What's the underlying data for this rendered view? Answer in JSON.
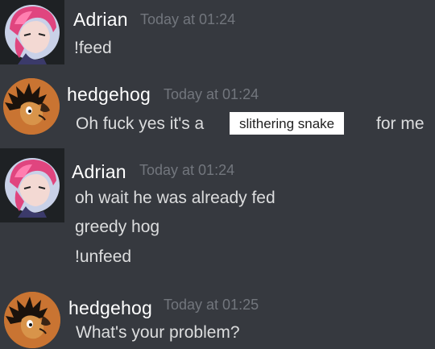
{
  "messages": [
    {
      "author": "Adrian",
      "avatar_icon": "pink-haired-girl-avatar",
      "timestamp": "Today at 01:24",
      "lines": [
        "!feed"
      ]
    },
    {
      "author": "hedgehog",
      "avatar_icon": "hedgehog-avatar",
      "timestamp": "Today at 01:24",
      "text_before": "Oh fuck yes it's a",
      "highlight": "slithering snake",
      "text_after": "for me"
    },
    {
      "author": "Adrian",
      "avatar_icon": "pink-haired-girl-avatar",
      "timestamp": "Today at 01:24",
      "lines": [
        "oh wait he was already fed",
        "greedy hog",
        "!unfeed"
      ]
    },
    {
      "author": "hedgehog",
      "avatar_icon": "hedgehog-avatar",
      "timestamp": "Today at 01:25",
      "lines": [
        "What's your problem?"
      ]
    }
  ],
  "colors": {
    "background": "#36393f",
    "username": "#ffffff",
    "timestamp": "#72767d",
    "message_text": "#dcddde"
  }
}
